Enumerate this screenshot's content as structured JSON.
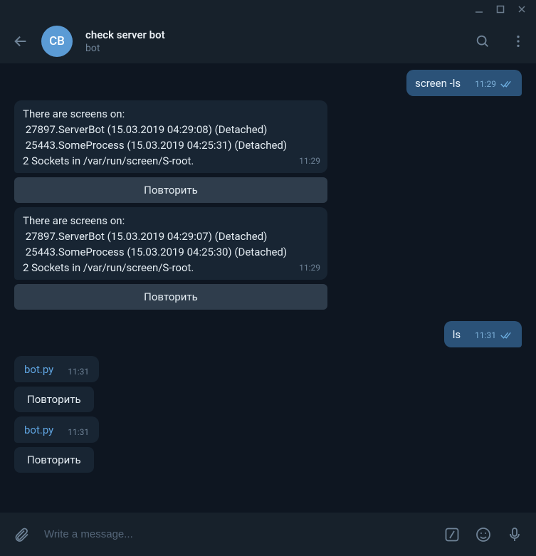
{
  "window": {
    "minimize": "–",
    "maximize": "▢",
    "close": "✕"
  },
  "header": {
    "avatar_initials": "CB",
    "title": "check server bot",
    "subtitle": "bot"
  },
  "messages": [
    {
      "side": "out",
      "text": "screen -ls",
      "time": "11:29",
      "read": true
    },
    {
      "side": "in",
      "lines": [
        "There are screens on:",
        " 27897.ServerBot (15.03.2019 04:29:08) (Detached)",
        " 25443.SomeProcess (15.03.2019 04:25:31) (Detached)",
        "2 Sockets in /var/run/screen/S-root."
      ],
      "time": "11:29",
      "button": "Повторить"
    },
    {
      "side": "in",
      "lines": [
        "There are screens on:",
        " 27897.ServerBot (15.03.2019 04:29:07) (Detached)",
        " 25443.SomeProcess (15.03.2019 04:25:30) (Detached)",
        "2 Sockets in /var/run/screen/S-root."
      ],
      "time": "11:29",
      "button": "Повторить"
    },
    {
      "side": "out",
      "text": "ls",
      "time": "11:31",
      "read": true
    },
    {
      "side": "in",
      "link": "bot.py",
      "time": "11:31",
      "button": "Повторить"
    },
    {
      "side": "in",
      "link": "bot.py",
      "time": "11:31",
      "button": "Повторить"
    }
  ],
  "input": {
    "placeholder": "Write a message..."
  }
}
